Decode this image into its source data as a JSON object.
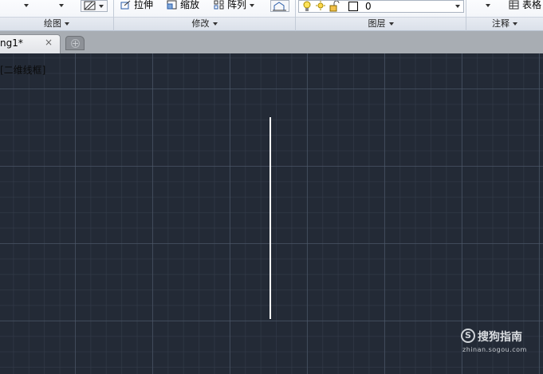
{
  "ribbon": {
    "panels": [
      {
        "title": "绘图"
      },
      {
        "title": "修改"
      },
      {
        "title": "图层"
      },
      {
        "title": "注释"
      }
    ],
    "modify": {
      "stretch": "拉伸",
      "scale": "缩放",
      "array": "阵列"
    },
    "layer": {
      "current": "0"
    },
    "annotate": {
      "table": "表格"
    }
  },
  "tabs": {
    "active": "ng1*",
    "close": "×"
  },
  "canvas": {
    "viewport_label": "[二维线框]",
    "background_color": "#232a36",
    "line_color": "#ffffff"
  },
  "watermark": {
    "logo_letter": "S",
    "text": "搜狗指南",
    "url": "zhinan.sogou.com"
  }
}
